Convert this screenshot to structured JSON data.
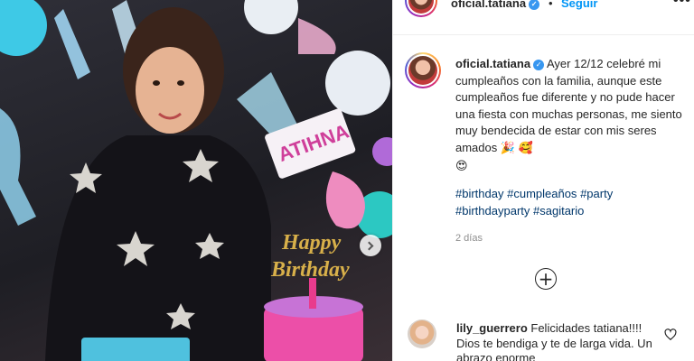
{
  "post": {
    "username": "oficial.tatiana",
    "follow_label": "Seguir",
    "separator": "•",
    "more_label": "•••",
    "carousel_next_icon": "chevron-right-icon"
  },
  "photo": {
    "balloon_letters": "ATIHNA",
    "cake_topper_line1": "Happy",
    "cake_topper_line2": "Birthday",
    "topper_colors": {
      "gold": "#d8b04a",
      "balloon_blue": "#58c8e8",
      "balloon_pink": "#e86fa3"
    }
  },
  "caption": {
    "username": "oficial.tatiana",
    "text": "Ayer 12/12 celebré mi cumpleaños con la familia, aunque este cumpleaños fue diferente y no pude hacer una fiesta con muchas personas, me siento muy bendecida de estar con mis seres amados",
    "emoji_1": "🎉",
    "emoji_2": "🥰",
    "emoji_3": "😍",
    "hashtags": [
      "#birthday",
      "#cumpleaños",
      "#party",
      "#birthdayparty",
      "#sagitario"
    ],
    "timestamp": "2 días"
  },
  "load_more_icon": "plus-circle-icon",
  "comment": {
    "username": "lily_guerrero",
    "text": "Felicidades tatiana!!!! Dios te bendiga y te de larga vida. Un abrazo enorme",
    "like_icon": "heart-icon"
  },
  "colors": {
    "link": "#00376b",
    "follow": "#0095f6",
    "muted": "#8e8e8e",
    "text": "#262626"
  }
}
